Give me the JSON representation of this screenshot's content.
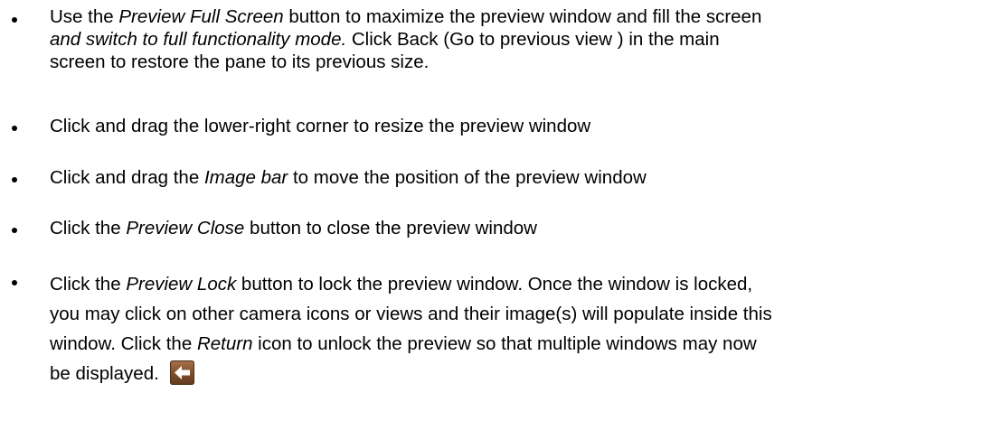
{
  "bullets": [
    {
      "lines": [
        [
          {
            "text": "Use the ",
            "italic": false
          },
          {
            "text": "Preview Full Screen",
            "italic": true
          },
          {
            "text": " button to maximize the preview window and fill the screen",
            "italic": false
          }
        ],
        [
          {
            "text": "and switch to full functionality mode.",
            "italic": true
          },
          {
            "text": " Click Back (Go to previous view ) in the main",
            "italic": false
          }
        ],
        [
          {
            "text": "screen to restore the pane to its previous size.",
            "italic": false
          }
        ]
      ]
    },
    {
      "lines": [
        [
          {
            "text": "Click and drag the lower-right corner to resize the preview window",
            "italic": false
          }
        ]
      ]
    },
    {
      "lines": [
        [
          {
            "text": "Click and drag the ",
            "italic": false
          },
          {
            "text": "Image bar",
            "italic": true
          },
          {
            "text": " to move the position of the preview window",
            "italic": false
          }
        ]
      ]
    },
    {
      "lines": [
        [
          {
            "text": "Click the ",
            "italic": false
          },
          {
            "text": "Preview Close",
            "italic": true
          },
          {
            "text": " button to close the preview window",
            "italic": false
          }
        ]
      ]
    },
    {
      "lines": [
        [
          {
            "text": "Click the ",
            "italic": false
          },
          {
            "text": "Preview Lock",
            "italic": true
          },
          {
            "text": " button to lock the preview window.  Once the window is locked,",
            "italic": false
          }
        ],
        [
          {
            "text": "you may click on other camera icons or views and their image(s) will populate inside this",
            "italic": false
          }
        ],
        [
          {
            "text": "window. Click the ",
            "italic": false
          },
          {
            "text": "Return",
            "italic": true
          },
          {
            "text": " icon to unlock the preview so that multiple windows may now",
            "italic": false
          }
        ],
        [
          {
            "text": "be displayed.",
            "italic": false
          }
        ]
      ]
    }
  ],
  "icons": {
    "return_icon": "return-arrow-icon",
    "return_icon_color": "#8a5a34",
    "return_arrow_color": "#ffffff"
  }
}
